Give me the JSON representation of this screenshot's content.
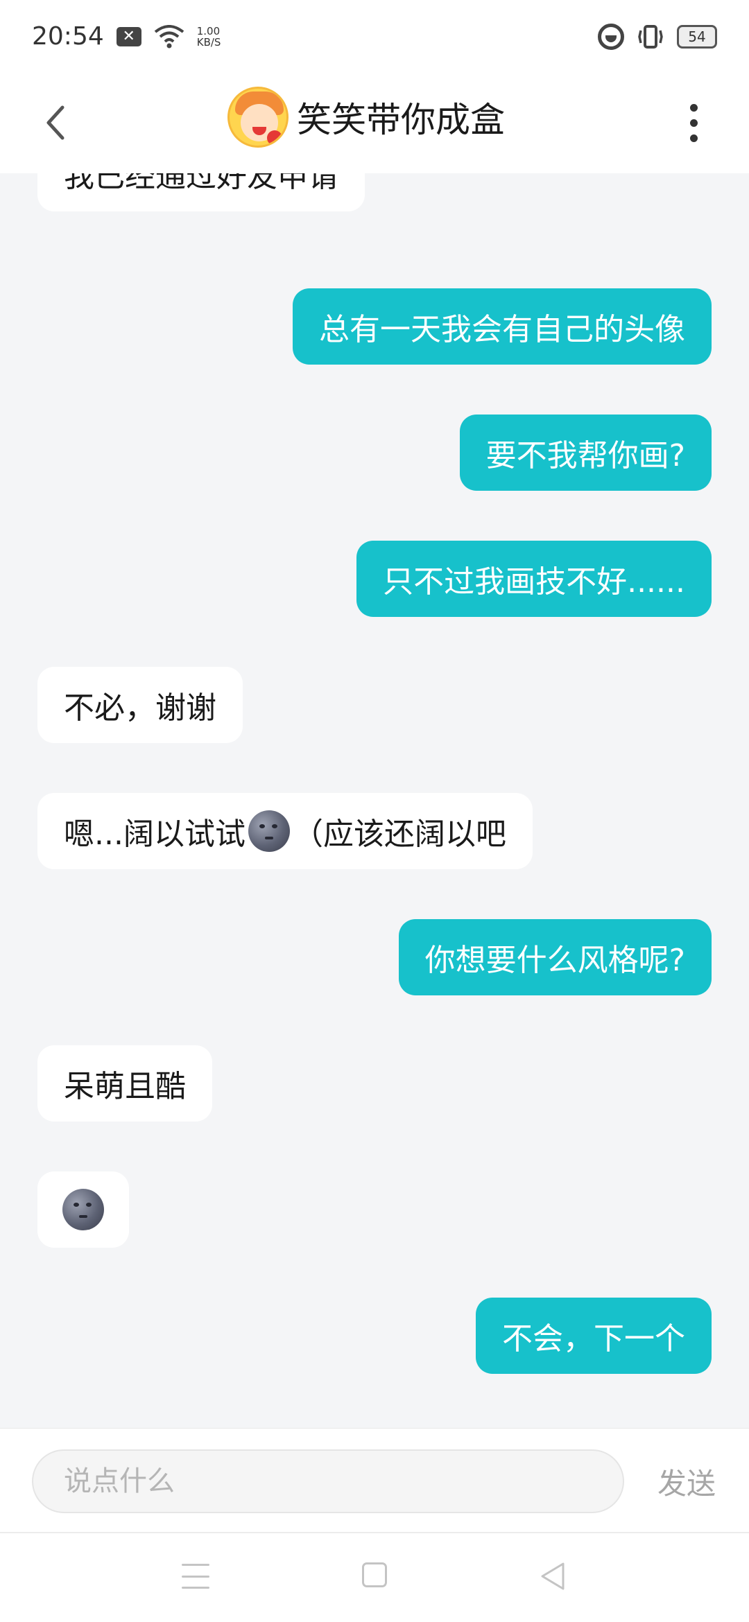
{
  "status_bar": {
    "time": "20:54",
    "network_speed_value": "1.00",
    "network_speed_unit": "KB/S",
    "battery": "54"
  },
  "header": {
    "title": "笑笑带你成盒",
    "avatar_icon": "cartoon-avatar-icon"
  },
  "messages": [
    {
      "side": "in",
      "text": "我已经通过好友申请"
    },
    {
      "side": "out",
      "text": "总有一天我会有自己的头像"
    },
    {
      "side": "out",
      "text": "要不我帮你画?"
    },
    {
      "side": "out",
      "text": "只不过我画技不好......"
    },
    {
      "side": "in",
      "text": "不必，谢谢"
    },
    {
      "side": "in",
      "text_before": "嗯...阔以试试",
      "emoji": "new-moon-face",
      "text_after": "（应该还阔以吧"
    },
    {
      "side": "out",
      "text": "你想要什么风格呢?"
    },
    {
      "side": "in",
      "text": "呆萌且酷"
    },
    {
      "side": "in",
      "emoji": "new-moon-face"
    },
    {
      "side": "out",
      "text": "不会，下一个"
    }
  ],
  "input_bar": {
    "placeholder": "说点什么",
    "value": "",
    "send_label": "发送"
  },
  "colors": {
    "outgoing_bubble": "#17c1cb",
    "incoming_bubble": "#ffffff",
    "background": "#f4f5f7"
  }
}
